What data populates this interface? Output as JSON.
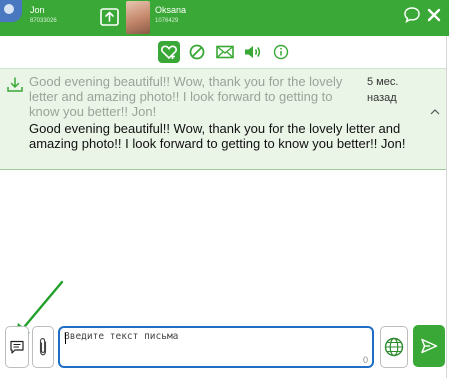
{
  "header": {
    "my_name": "Jon",
    "my_id": "87033026",
    "partner_name": "Oksana",
    "partner_id": "1076429",
    "icons": [
      "upload-icon",
      "chat-bubble-icon",
      "close-icon"
    ]
  },
  "toolbar": {
    "items": [
      {
        "name": "favorite-plus-icon",
        "active": true
      },
      {
        "name": "block-icon",
        "active": false
      },
      {
        "name": "mail-icon",
        "active": false
      },
      {
        "name": "sound-icon",
        "active": false
      },
      {
        "name": "info-icon",
        "active": false
      }
    ]
  },
  "message": {
    "original_text": "Good evening beautiful!! Wow, thank you for the lovely letter and amazing photo!! I look forward to getting to know you better!! Jon!",
    "translated_text": "Good evening beautiful!! Wow, thank you for the lovely letter and amazing photo!! I look forward to getting to know you better!! Jon!",
    "time": "5 мес. назад"
  },
  "composer": {
    "placeholder": "Введите текст письма",
    "char_count": "0"
  },
  "colors": {
    "brand_green": "#3aa836",
    "panel_bg": "#eaf5e8",
    "focus_blue": "#1e6ec4"
  }
}
